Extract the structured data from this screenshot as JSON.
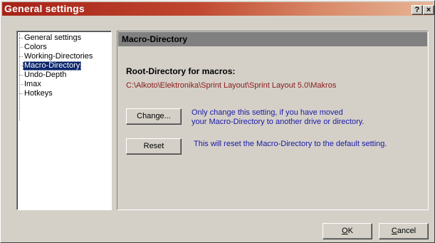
{
  "window": {
    "title": "General settings",
    "help_label": "?",
    "close_label": "×"
  },
  "tree": {
    "items": [
      {
        "label": "General settings",
        "selected": false
      },
      {
        "label": "Colors",
        "selected": false
      },
      {
        "label": "Working-Directories",
        "selected": false
      },
      {
        "label": "Macro-Directory",
        "selected": true
      },
      {
        "label": "Undo-Depth",
        "selected": false
      },
      {
        "label": "Imax",
        "selected": false
      },
      {
        "label": "Hotkeys",
        "selected": false
      }
    ]
  },
  "panel": {
    "header": "Macro-Directory",
    "section_title": "Root-Directory for macros:",
    "path": "C:\\Alkoto\\Elektronika\\Sprint Layout\\Sprint Layout 5.0\\Makros",
    "change_button": "Change...",
    "change_info_line1": "Only change this setting, if you have moved",
    "change_info_line2": "your Macro-Directory to another drive or directory.",
    "reset_button": "Reset",
    "reset_info": "This will reset the Macro-Directory to the default setting."
  },
  "footer": {
    "ok_accel": "O",
    "ok_rest": "K",
    "cancel_accel": "C",
    "cancel_rest": "ancel"
  },
  "colors": {
    "title_gradient_start": "#a62217",
    "selection": "#0a246a",
    "path_text": "#8b1a1a",
    "info_text": "#1a1aa6",
    "header_bg": "#808080"
  }
}
